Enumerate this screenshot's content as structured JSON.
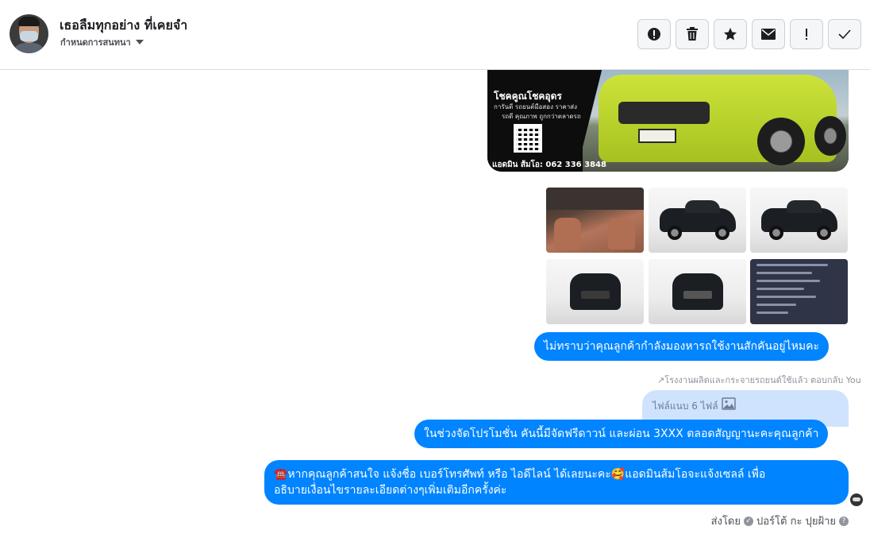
{
  "header": {
    "title": "เธอลืมทุกอย่าง ที่เคยจำ",
    "subtitle": "กำหนดการสนทนา"
  },
  "toolbar": {
    "buttons": [
      {
        "icon": "alert-circle-icon"
      },
      {
        "icon": "trash-icon"
      },
      {
        "icon": "star-icon"
      },
      {
        "icon": "mail-icon"
      },
      {
        "icon": "exclamation-icon"
      },
      {
        "icon": "check-icon"
      }
    ]
  },
  "banner": {
    "title": "โชคคูณโชคอุดร",
    "line1": "การันตี รถยนต์มือสอง ราคาส่ง",
    "line2": "รถดี คุณภาพ ถูกกว่าตลาดรถ",
    "phone": "แอดมิน ส้มโอ: 062 336 3848"
  },
  "messages": {
    "m1": "ไม่ทราบว่าคุณลูกค้ากำลังมองหารถใช้งานสักคันอยู่ไหมคะ",
    "reply_label": "↗โรงงานผลิตและกระจายรถยนต์ใช้แล้ว ตอบกลับ You",
    "attachment": "ไฟล์แนบ 6 ไฟล์",
    "m2": "ในช่วงจัดโปรโมชั่น คันนี้มีจัดฟรีดาวน์ และผ่อน 3XXX ตลอดสัญญานะคะคุณลูกค้า",
    "m3_line1": "☎️หากคุณลูกค้าสนใจ แจ้งชื่อ เบอร์โทรศัพท์ หรือ ไอดีไลน์  ได้เลยนะคะ🥰แอดมินส้มโอจะแจ้งเซลล์   เพื่อ",
    "m3_line2": "อธิบายเงื่อนไขรายละเอียดต่างๆเพิ่มเติมอีกครั้งค่ะ"
  },
  "footer": {
    "sent_by": "ส่งโดย",
    "author": "ปอร์โต้ กะ ปุยฝ้าย",
    "help": "?"
  },
  "colors": {
    "bubble": "#0084ff",
    "attachment_bg": "#cfe3ff",
    "header_border": "#dadde1"
  }
}
